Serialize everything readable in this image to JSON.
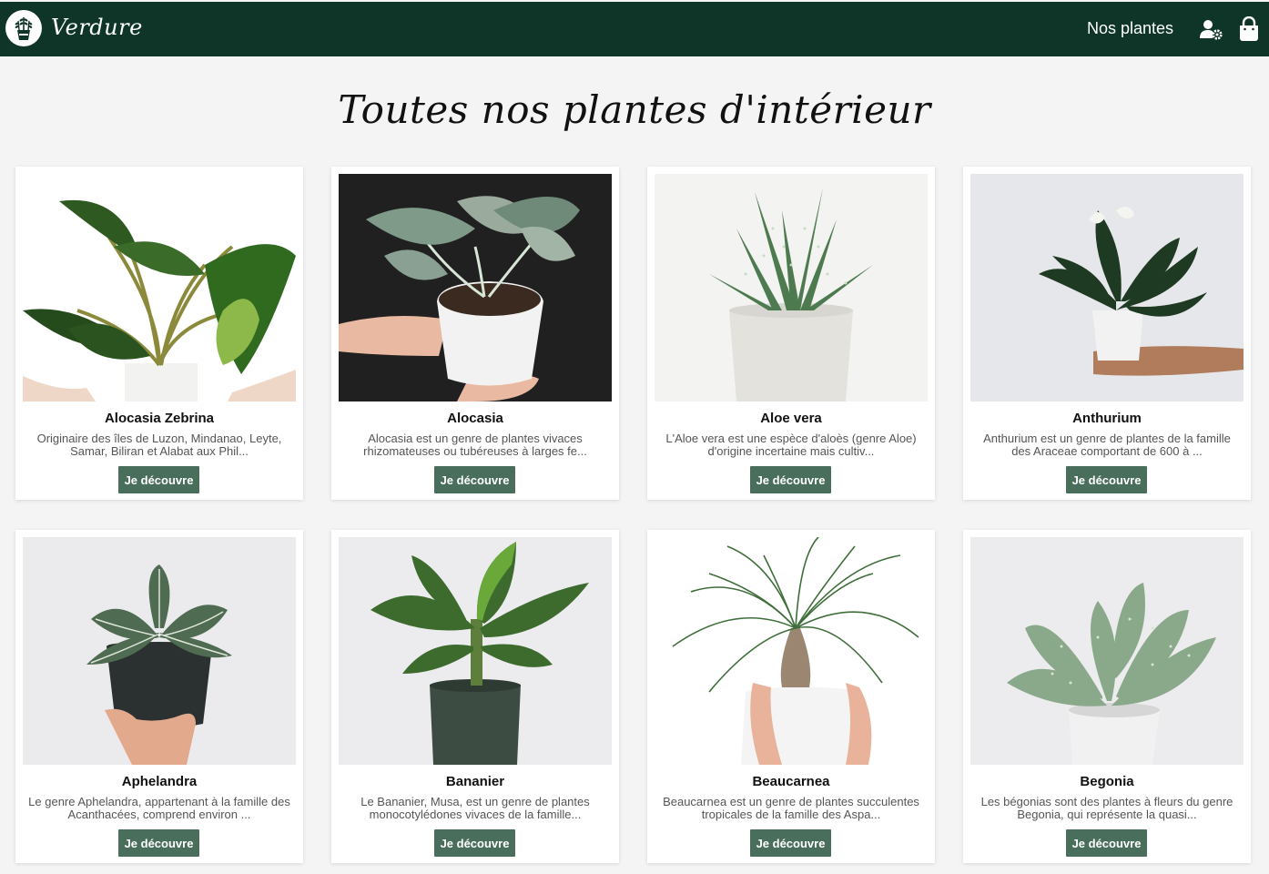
{
  "brand": {
    "name": "Verdure"
  },
  "nav": {
    "link": "Nos plantes",
    "icons": [
      "user-settings-icon",
      "shopping-bag-icon"
    ]
  },
  "page": {
    "title": "Toutes nos plantes d'intérieur"
  },
  "colors": {
    "navbar": "#0e3528",
    "button": "#4a6e5c",
    "background": "#f4f4f4"
  },
  "products": [
    {
      "name": "Alocasia Zebrina",
      "description": "Originaire des îles de Luzon, Mindanao, Leyte, Samar, Biliran et Alabat aux Phil...",
      "button": "Je découvre"
    },
    {
      "name": "Alocasia",
      "description": "Alocasia est un genre de plantes vivaces rhizomateuses ou tubéreuses à larges fe...",
      "button": "Je découvre"
    },
    {
      "name": "Aloe vera",
      "description": "L'Aloe vera est une espèce d'aloès (genre Aloe) d'origine incertaine mais cultiv...",
      "button": "Je découvre"
    },
    {
      "name": "Anthurium",
      "description": "Anthurium est un genre de plantes de la famille des Araceae comportant de 600 à ...",
      "button": "Je découvre"
    },
    {
      "name": "Aphelandra",
      "description": "Le genre Aphelandra, appartenant à la famille des Acanthacées, comprend environ ...",
      "button": "Je découvre"
    },
    {
      "name": "Bananier",
      "description": "Le Bananier, Musa, est un genre de plantes monocotylédones vivaces de la famille...",
      "button": "Je découvre"
    },
    {
      "name": "Beaucarnea",
      "description": "Beaucarnea est un genre de plantes succulentes tropicales de la famille des Aspa...",
      "button": "Je découvre"
    },
    {
      "name": "Begonia",
      "description": "Les bégonias sont des plantes à fleurs du genre Begonia, qui représente la quasi...",
      "button": "Je découvre"
    }
  ]
}
